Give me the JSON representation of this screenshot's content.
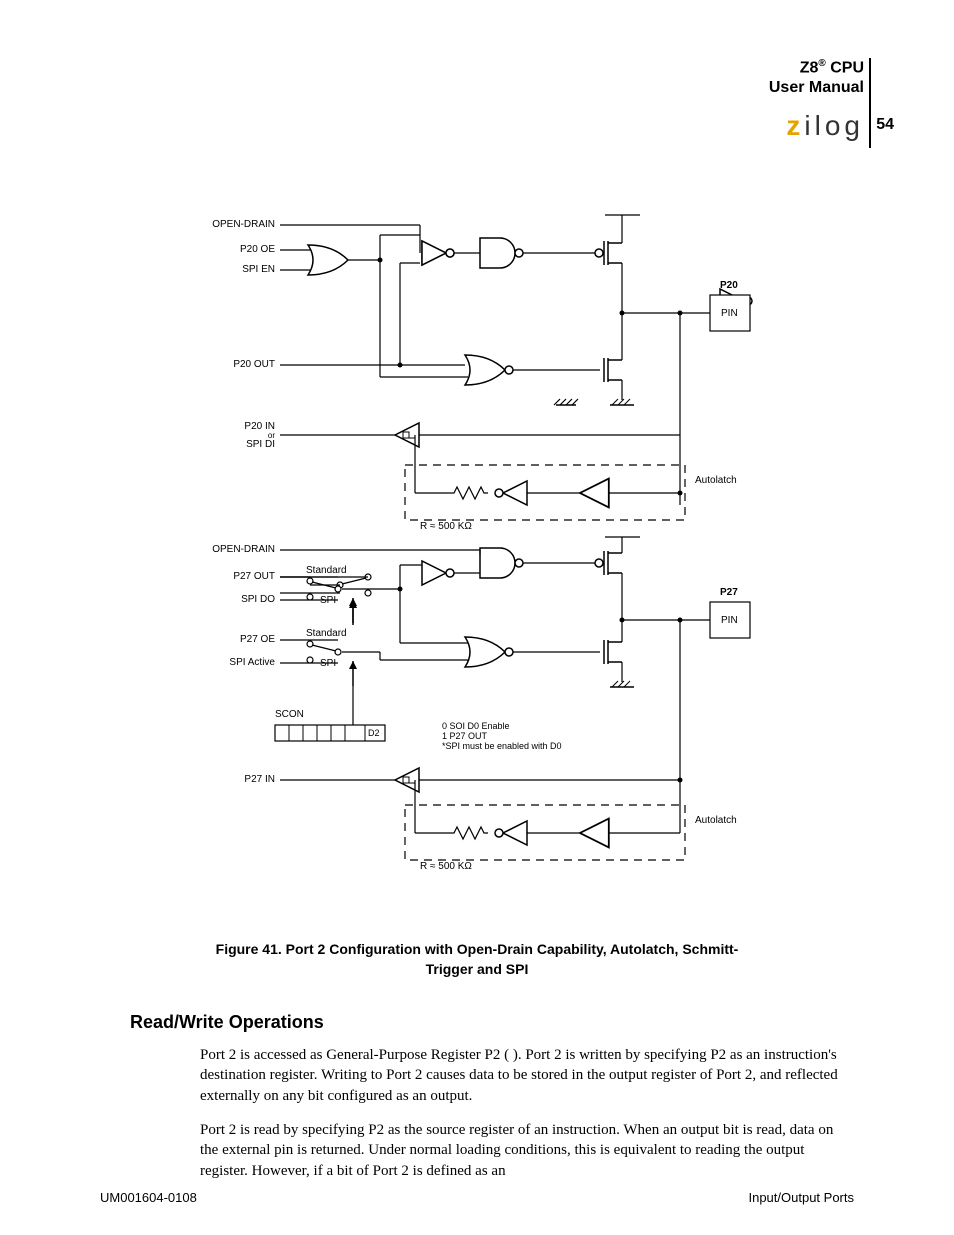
{
  "header": {
    "line1_prefix": "Z8",
    "line1_sup": "®",
    "line1_suffix": " CPU",
    "line2": "User Manual",
    "logo_z": "z",
    "logo_rest": "ilog",
    "page": "54"
  },
  "diagram": {
    "labels": {
      "open_drain_1": "OPEN-DRAIN",
      "p20_oe": "P20 OE",
      "spi_en": "SPI EN",
      "p20_out": "P20 OUT",
      "p20_in_line1": "P20 IN",
      "p20_in_line2": "or",
      "p20_in_line3": "SPI  DI",
      "autolatch_1": "Autolatch",
      "r500_1": "R ≈ 500 KΩ",
      "open_drain_2": "OPEN-DRAIN",
      "p27_out": "P27 OUT",
      "spi_do": "SPI DO",
      "standard_1": "Standard",
      "spi_1": "SPI",
      "p27_oe": "P27 OE",
      "spi_active": "SPI Active",
      "standard_2": "Standard",
      "spi_2": "SPI",
      "scon": "SCON",
      "d2": "D2",
      "note_0": "0  SOI D0 Enable",
      "note_1": "1  P27 OUT",
      "note_star": "*SPI  must be enabled with D0",
      "p27_in": "P27 IN",
      "autolatch_2": "Autolatch",
      "r500_2": "R ≈ 500 KΩ",
      "p20": "P20",
      "pin_1": "PIN",
      "p27": "P27",
      "pin_2": "PIN"
    }
  },
  "caption": {
    "line1": "Figure 41. Port 2 Configuration with Open-Drain Capability, Autolatch, Schmitt-",
    "line2": "Trigger and SPI"
  },
  "section": {
    "head": "Read/Write Operations",
    "p1": "Port 2 is accessed as General-Purpose Register P2 (       ). Port 2 is written by specifying P2 as an instruction's destination register. Writing to Port 2 causes data to be stored in the output register of Port 2, and reflected externally on any bit configured as an output.",
    "p2": "Port 2 is read by specifying P2 as the source register of an instruction. When an output bit is read, data on the external pin is returned. Under normal loading conditions, this is equivalent to reading the output register. However, if a bit of Port 2 is defined as an"
  },
  "footer": {
    "left": "UM001604-0108",
    "right": "Input/Output Ports"
  }
}
